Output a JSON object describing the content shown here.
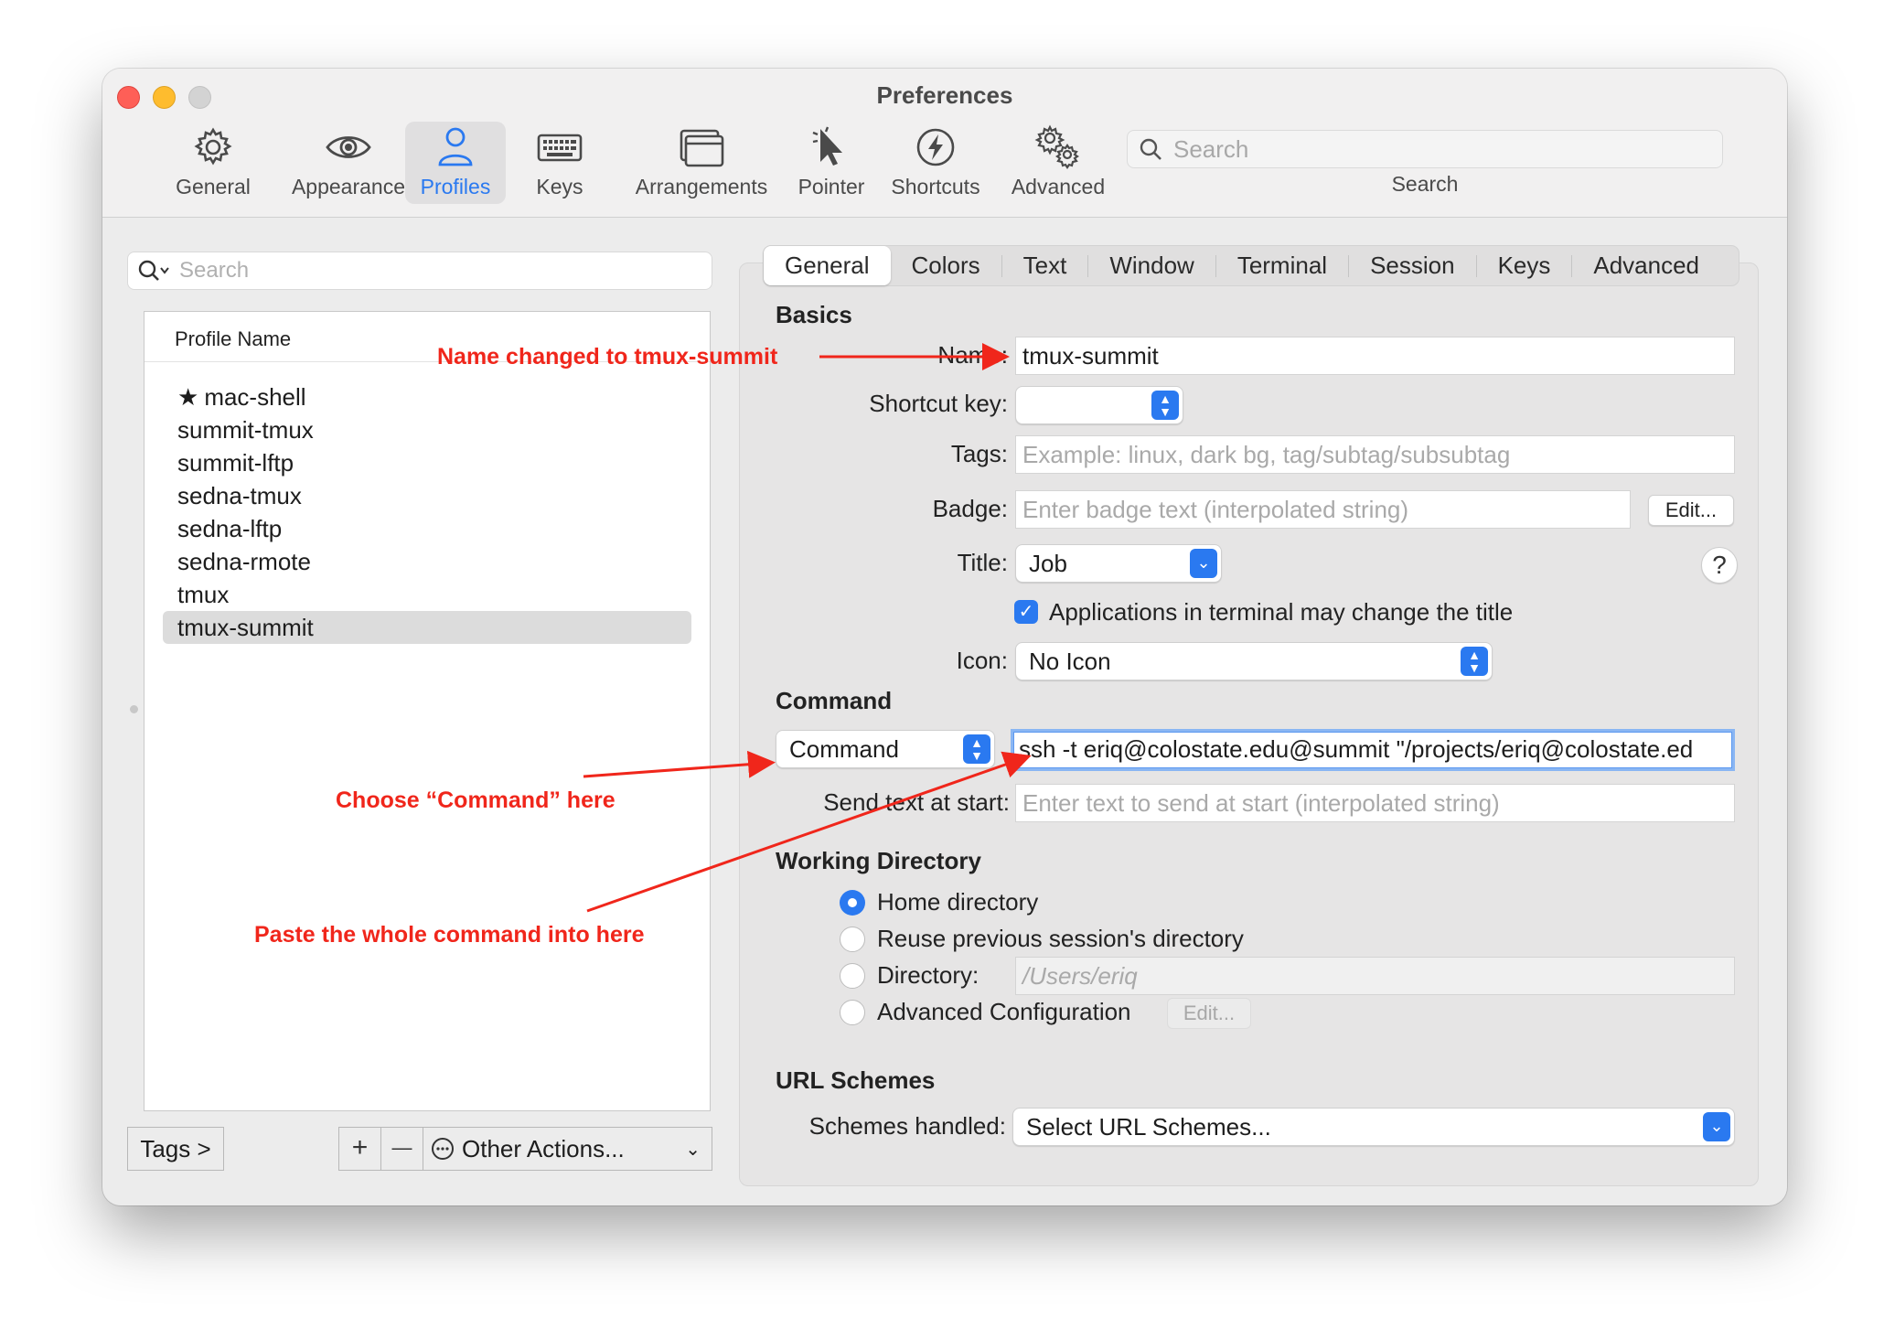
{
  "window": {
    "title": "Preferences"
  },
  "toolbar": {
    "items": [
      {
        "label": "General",
        "icon": "gear-icon"
      },
      {
        "label": "Appearance",
        "icon": "eye-icon"
      },
      {
        "label": "Profiles",
        "icon": "person-icon"
      },
      {
        "label": "Keys",
        "icon": "keyboard-icon"
      },
      {
        "label": "Arrangements",
        "icon": "window-icon"
      },
      {
        "label": "Pointer",
        "icon": "pointer-icon"
      },
      {
        "label": "Shortcuts",
        "icon": "bolt-icon"
      },
      {
        "label": "Advanced",
        "icon": "gears-icon"
      }
    ],
    "active": "Profiles",
    "search_placeholder": "Search",
    "search_label": "Search"
  },
  "profiles": {
    "search_placeholder": "Search",
    "header": "Profile Name",
    "items": [
      "mac-shell",
      "summit-tmux",
      "summit-lftp",
      "sedna-tmux",
      "sedna-lftp",
      "sedna-rmote",
      "tmux",
      "tmux-summit"
    ],
    "default_marker": "★",
    "selected": "tmux-summit",
    "tags_button": "Tags >",
    "add_button": "+",
    "remove_button": "—",
    "other_actions": "Other Actions..."
  },
  "tabs": [
    "General",
    "Colors",
    "Text",
    "Window",
    "Terminal",
    "Session",
    "Keys",
    "Advanced"
  ],
  "active_tab": "General",
  "basics": {
    "heading": "Basics",
    "name_label": "Name:",
    "name_value": "tmux-summit",
    "shortcut_label": "Shortcut key:",
    "tags_label": "Tags:",
    "tags_placeholder": "Example: linux, dark bg, tag/subtag/subsubtag",
    "badge_label": "Badge:",
    "badge_placeholder": "Enter badge text (interpolated string)",
    "badge_edit": "Edit...",
    "title_label": "Title:",
    "title_value": "Job",
    "help": "?",
    "apps_change_title": "Applications in terminal may change the title",
    "icon_label": "Icon:",
    "icon_value": "No Icon"
  },
  "command": {
    "heading": "Command",
    "type": "Command",
    "value": "ssh -t eriq@colostate.edu@summit \"/projects/eriq@colostate.ed",
    "send_text_label": "Send text at start:",
    "send_text_placeholder": "Enter text to send at start (interpolated string)"
  },
  "working_directory": {
    "heading": "Working Directory",
    "options": [
      "Home directory",
      "Reuse previous session's directory",
      "Directory:",
      "Advanced Configuration"
    ],
    "selected": "Home directory",
    "directory_value": "/Users/eriq",
    "advanced_edit": "Edit..."
  },
  "url_schemes": {
    "heading": "URL Schemes",
    "label": "Schemes handled:",
    "value": "Select URL Schemes..."
  },
  "annotations": {
    "name_note": "Name changed to tmux-summit",
    "command_note": "Choose “Command” here",
    "paste_note": "Paste the whole command into here",
    "color": "#f0261b"
  },
  "colors": {
    "accent": "#2a79f0",
    "annotation": "#f0261b"
  }
}
